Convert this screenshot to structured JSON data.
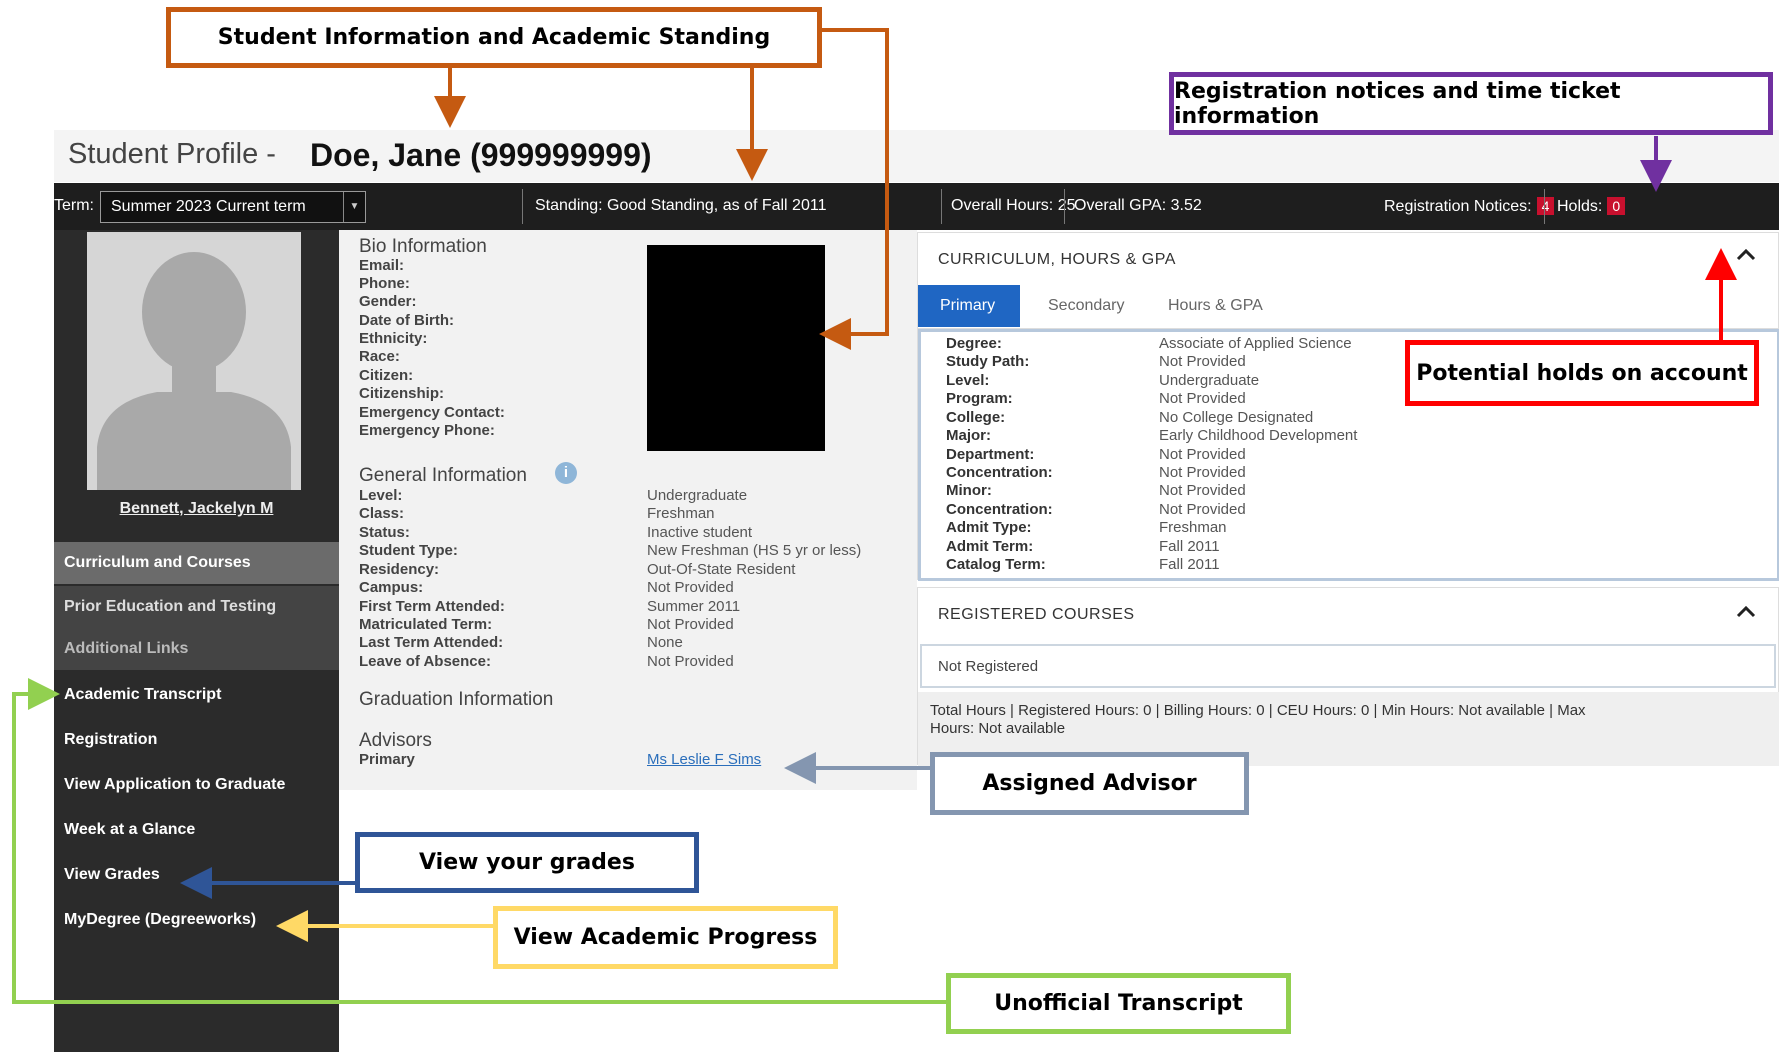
{
  "header": {
    "label": "Student Profile -",
    "student_name": "Doe, Jane (999999999)"
  },
  "topbar": {
    "term_label": "Term:",
    "term_value": "Summer 2023 Current term",
    "standing": "Standing: Good Standing, as of Fall 2011",
    "overall_hours": "Overall Hours: 25",
    "overall_gpa": "Overall GPA: 3.52",
    "reg_notices_label": "Registration Notices:",
    "reg_notices_count": "4",
    "holds_label": "Holds:",
    "holds_count": "0"
  },
  "sidebar": {
    "photo_name": "Bennett, Jackelyn M",
    "sections": [
      "Curriculum and Courses",
      "Prior Education and Testing",
      "Additional Links"
    ],
    "links": [
      "Academic Transcript",
      "Registration",
      "View Application to Graduate",
      "Week at a Glance",
      "View Grades",
      "MyDegree (Degreeworks)"
    ]
  },
  "bio": {
    "title": "Bio Information",
    "labels": [
      "Email:",
      "Phone:",
      "Gender:",
      "Date of Birth:",
      "Ethnicity:",
      "Race:",
      "Citizen:",
      "Citizenship:",
      "Emergency Contact:",
      "Emergency Phone:"
    ]
  },
  "general": {
    "title": "General Information",
    "info_icon": "i",
    "rows": [
      {
        "label": "Level:",
        "value": "Undergraduate"
      },
      {
        "label": "Class:",
        "value": "Freshman"
      },
      {
        "label": "Status:",
        "value": "Inactive student"
      },
      {
        "label": "Student Type:",
        "value": "New Freshman (HS 5 yr or less)"
      },
      {
        "label": "Residency:",
        "value": "Out-Of-State Resident"
      },
      {
        "label": "Campus:",
        "value": "Not Provided"
      },
      {
        "label": "First Term Attended:",
        "value": "Summer 2011"
      },
      {
        "label": "Matriculated Term:",
        "value": "Not Provided"
      },
      {
        "label": "Last Term Attended:",
        "value": "None"
      },
      {
        "label": "Leave of Absence:",
        "value": "Not Provided"
      }
    ]
  },
  "graduation": {
    "title": "Graduation Information"
  },
  "advisors": {
    "title": "Advisors",
    "primary_label": "Primary",
    "primary_value": "Ms Leslie F Sims"
  },
  "curriculum": {
    "title": "CURRICULUM, HOURS & GPA",
    "tabs": [
      "Primary",
      "Secondary",
      "Hours & GPA"
    ],
    "rows": [
      {
        "label": "Degree:",
        "value": "Associate of Applied Science"
      },
      {
        "label": "Study Path:",
        "value": "Not Provided"
      },
      {
        "label": "Level:",
        "value": "Undergraduate"
      },
      {
        "label": "Program:",
        "value": "Not Provided"
      },
      {
        "label": "College:",
        "value": "No College Designated"
      },
      {
        "label": "Major:",
        "value": "Early Childhood Development"
      },
      {
        "label": "Department:",
        "value": "Not Provided"
      },
      {
        "label": "Concentration:",
        "value": "Not Provided"
      },
      {
        "label": "Minor:",
        "value": "Not Provided"
      },
      {
        "label": "Concentration:",
        "value": "Not Provided"
      },
      {
        "label": "Admit Type:",
        "value": "Freshman"
      },
      {
        "label": "Admit Term:",
        "value": "Fall 2011"
      },
      {
        "label": "Catalog Term:",
        "value": "Fall 2011"
      }
    ]
  },
  "registered": {
    "title": "REGISTERED COURSES",
    "status": "Not Registered",
    "summary_line1": "Total Hours |  Registered Hours:  0  |  Billing Hours:  0  |  CEU Hours:  0  | Min Hours:  Not available  |  Max",
    "summary_line2": "Hours:  Not available"
  },
  "annotations": {
    "student_info": "Student Information and Academic Standing",
    "reg_notices": "Registration notices and time ticket information",
    "holds": "Potential holds on account",
    "advisor": "Assigned Advisor",
    "grades": "View your grades",
    "progress": "View Academic Progress",
    "transcript": "Unofficial Transcript"
  },
  "colors": {
    "orange": "#c55a11",
    "purple": "#7030a0",
    "red": "#ff0000",
    "slate": "#8496b0",
    "blue": "#2f5597",
    "yellow": "#ffd966",
    "green": "#92d050"
  }
}
